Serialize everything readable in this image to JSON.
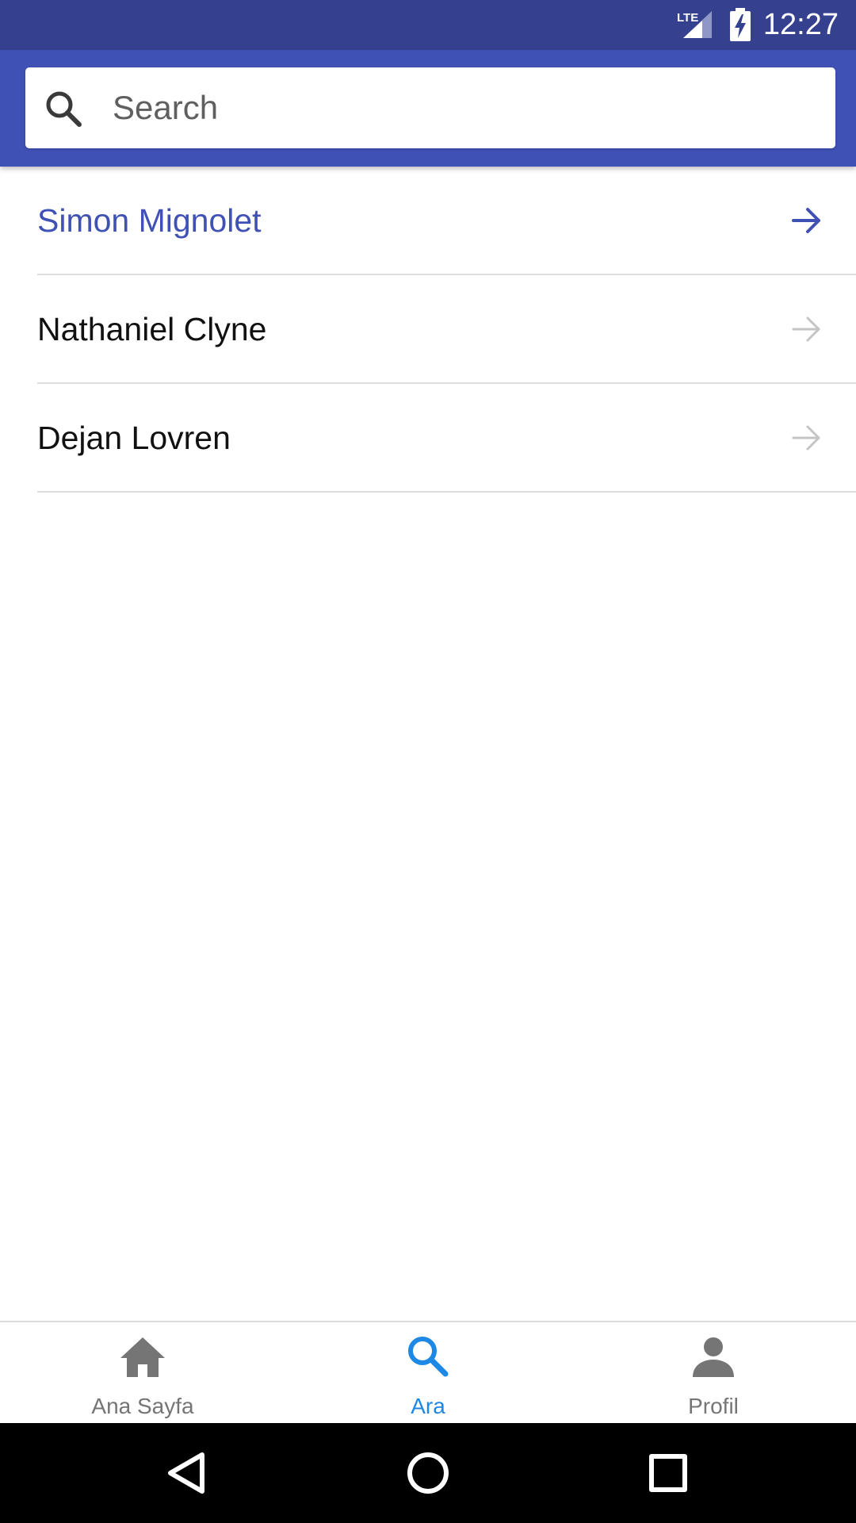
{
  "status_bar": {
    "time": "12:27",
    "network": "LTE",
    "icons": [
      "lte-signal-icon",
      "battery-charging-icon"
    ]
  },
  "search": {
    "placeholder": "Search",
    "value": "",
    "icon": "search-icon"
  },
  "results": [
    {
      "name": "Simon Mignolet",
      "active": true
    },
    {
      "name": "Nathaniel Clyne",
      "active": false
    },
    {
      "name": "Dejan Lovren",
      "active": false
    }
  ],
  "bottom_nav": {
    "items": [
      {
        "label": "Ana Sayfa",
        "icon": "home-icon",
        "active": false
      },
      {
        "label": "Ara",
        "icon": "search-icon",
        "active": true
      },
      {
        "label": "Profil",
        "icon": "person-icon",
        "active": false
      }
    ]
  },
  "system_nav": {
    "buttons": [
      "back-icon",
      "home-circle-icon",
      "recents-icon"
    ]
  },
  "colors": {
    "status_bar": "#35408f",
    "app_bar": "#3f51b5",
    "active_item": "#3f51b5",
    "active_nav": "#1e88e5",
    "inactive_nav": "#757575"
  }
}
